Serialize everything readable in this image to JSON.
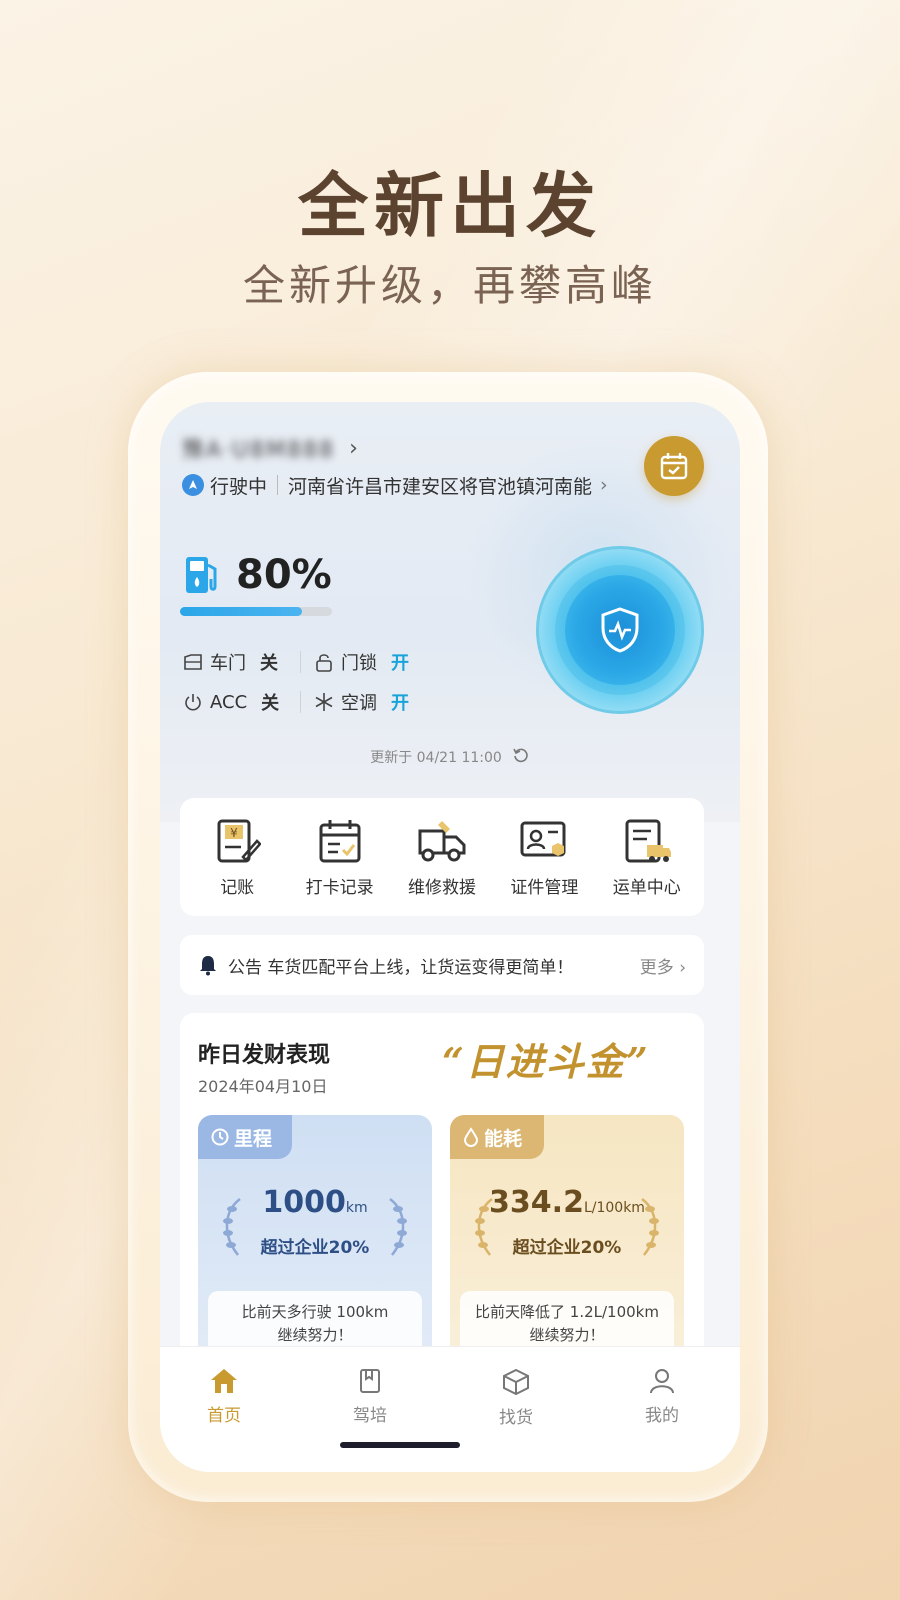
{
  "promo": {
    "headline": "全新出发",
    "subline": "全新升级，再攀高峰"
  },
  "vehicle": {
    "plate": "豫A·U8M888",
    "status": "行驶中",
    "location": "河南省许昌市建安区将官池镇河南能",
    "fuel_percent": "80%",
    "fuel_level": 0.8,
    "door_label": "车门",
    "door_value": "关",
    "lock_label": "门锁",
    "lock_value": "开",
    "acc_label": "ACC",
    "acc_value": "关",
    "ac_label": "空调",
    "ac_value": "开",
    "updated": "更新于 04/21 11:00"
  },
  "quick_actions": [
    {
      "label": "记账",
      "icon": "ledger-icon"
    },
    {
      "label": "打卡记录",
      "icon": "calendar-check-icon"
    },
    {
      "label": "维修救援",
      "icon": "truck-wrench-icon"
    },
    {
      "label": "证件管理",
      "icon": "id-card-icon"
    },
    {
      "label": "运单中心",
      "icon": "waybill-icon"
    }
  ],
  "notice": {
    "prefix": "公告",
    "text": "车货匹配平台上线，让货运变得更简单！",
    "more": "更多"
  },
  "performance": {
    "title": "昨日发财表现",
    "date": "2024年04月10日",
    "motto": "“日进斗金”",
    "mileage": {
      "tag": "里程",
      "value": "1000",
      "unit": "km",
      "rank": "超过企业20%",
      "note_line1": "比前天多行驶 100km",
      "note_line2": "继续努力！"
    },
    "energy": {
      "tag": "能耗",
      "value": "334.2",
      "unit": "L/100km",
      "rank": "超过企业20%",
      "note_line1": "比前天降低了 1.2L/100km",
      "note_line2": "继续努力！"
    }
  },
  "tabs": [
    {
      "label": "首页",
      "icon": "home-icon",
      "active": true
    },
    {
      "label": "驾培",
      "icon": "book-icon"
    },
    {
      "label": "找货",
      "icon": "box-icon"
    },
    {
      "label": "我的",
      "icon": "user-icon"
    }
  ],
  "colors": {
    "accent_gold": "#c99a30",
    "accent_blue": "#1aa3d8",
    "headline_brown": "#5b4330"
  }
}
